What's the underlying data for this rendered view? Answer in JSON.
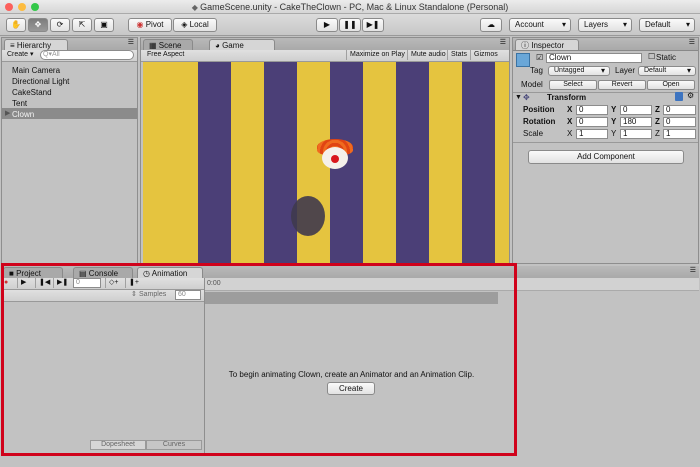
{
  "window": {
    "title": "GameScene.unity - CakeTheClown - PC, Mac & Linux Standalone (Personal)"
  },
  "toolbar": {
    "pivot_label": "Pivot",
    "local_label": "Local",
    "account_label": "Account",
    "layers_label": "Layers",
    "layout_label": "Default"
  },
  "hierarchy": {
    "tab_label": "Hierarchy",
    "create_label": "Create",
    "search_placeholder": "Q▾All",
    "items": [
      "Main Camera",
      "Directional Light",
      "CakeStand",
      "Tent",
      "Clown"
    ],
    "selected_index": 4
  },
  "scene_tab": "Scene",
  "game": {
    "tab_label": "Game",
    "aspect_label": "Free Aspect",
    "maximize_label": "Maximize on Play",
    "mute_label": "Mute audio",
    "stats_label": "Stats",
    "gizmos_label": "Gizmos",
    "colors": {
      "yellow": "#e5c43f",
      "purple": "#4b3f77"
    }
  },
  "inspector": {
    "tab_label": "Inspector",
    "object_name": "Clown",
    "static_label": "Static",
    "tag_label": "Tag",
    "tag_value": "Untagged",
    "layer_label": "Layer",
    "layer_value": "Default",
    "model_label": "Model",
    "select_label": "Select",
    "revert_label": "Revert",
    "open_label": "Open",
    "transform_label": "Transform",
    "position_label": "Position",
    "rotation_label": "Rotation",
    "scale_label": "Scale",
    "position": {
      "x": "0",
      "y": "0",
      "z": "0"
    },
    "rotation": {
      "x": "0",
      "y": "180",
      "z": "0"
    },
    "scale": {
      "x": "1",
      "y": "1",
      "z": "1"
    },
    "add_component_label": "Add Component"
  },
  "bottom": {
    "project_tab": "Project",
    "console_tab": "Console",
    "animation_tab": "Animation",
    "samples_label": "Samples",
    "samples_value": "60",
    "frame_value": "0",
    "time_label": "0:00",
    "message": "To begin animating Clown, create an Animator and an Animation Clip.",
    "create_label": "Create",
    "dopesheet_label": "Dopesheet",
    "curves_label": "Curves",
    "highlight_color": "#d0021b"
  }
}
